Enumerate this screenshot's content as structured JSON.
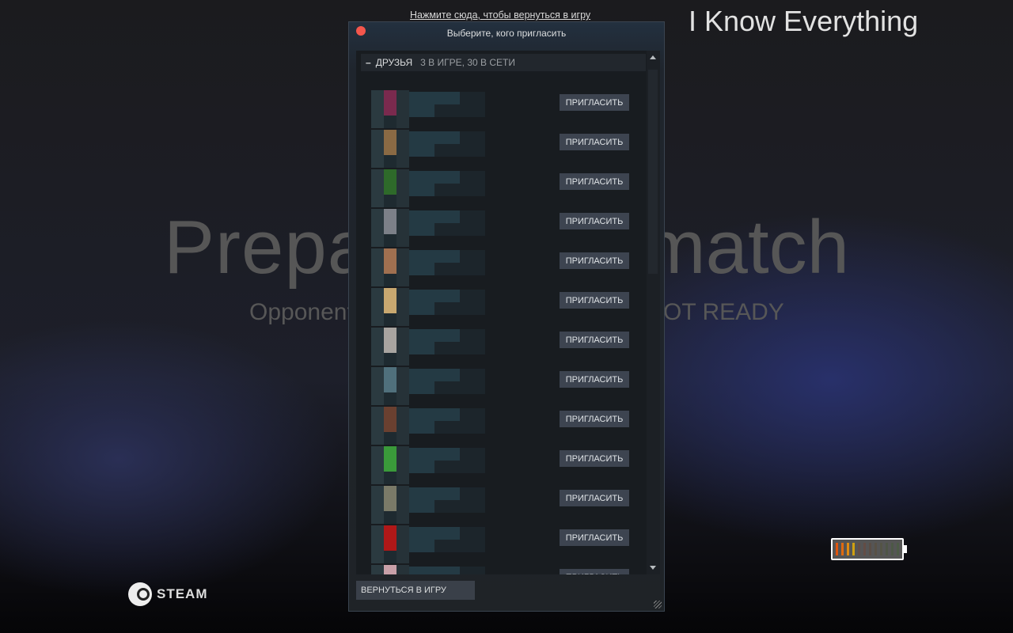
{
  "background": {
    "game_title": "I Know Everything",
    "headline_left": "Prepa",
    "headline_right": "match",
    "subline_left": "Opponent",
    "subline_right": "OT READY"
  },
  "overlay": {
    "return_link": "Нажмите сюда, чтобы вернуться в игру",
    "steam_label": "STEAM",
    "battery_level_fraction": 0.33
  },
  "dialog": {
    "title": "Выберите, кого пригласить",
    "group": {
      "collapse_symbol": "–",
      "name": "ДРУЗЬЯ",
      "counts": "3 В ИГРЕ, 30 В СЕТИ"
    },
    "invite_label": "ПРИГЛАСИТЬ",
    "friends": [
      {
        "avatar_color": "#7a2a4e"
      },
      {
        "avatar_color": "#8a6a44"
      },
      {
        "avatar_color": "#2e6a2a"
      },
      {
        "avatar_color": "#7c8088"
      },
      {
        "avatar_color": "#a07050"
      },
      {
        "avatar_color": "#c8a870"
      },
      {
        "avatar_color": "#a8a4a0"
      },
      {
        "avatar_color": "#50707c"
      },
      {
        "avatar_color": "#6a4030"
      },
      {
        "avatar_color": "#3a9a3a"
      },
      {
        "avatar_color": "#7a7a68"
      },
      {
        "avatar_color": "#b01818"
      },
      {
        "avatar_color": "#c8a0a8"
      }
    ],
    "return_button": "ВЕРНУТЬСЯ В ИГРУ"
  }
}
